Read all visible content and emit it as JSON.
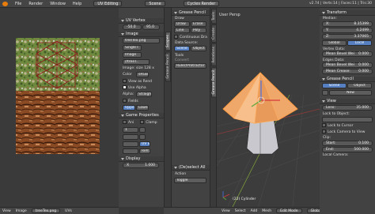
{
  "topbar": {
    "menu": [
      "File",
      "Render",
      "Window",
      "Help"
    ],
    "layout": "UV Editing",
    "scene": "Scene",
    "engine": "Cycles Render",
    "stats": "v2.74 | Verts:14 | Faces:11 | Tris:30"
  },
  "uv_panel": {
    "sec_uv_vertex": "UV Vertex",
    "uv_x": "-50.0",
    "uv_y": "95.0",
    "sec_image": "Image",
    "image_name": "treeTex.png",
    "image_user": "Single I",
    "source": "Image",
    "file": "//treeT..",
    "size": "Image: size 128 x",
    "color_label": "Color",
    "color_value": "sRGB",
    "view_as_render": "View as Rend",
    "use_alpha": "Use Alpha",
    "alpha_label": "Alpha:",
    "alpha_value": "Straight",
    "fields_label": "Fields",
    "upper_first": "Upper First",
    "lower_first": "Lower Fir",
    "sec_game": "Game Properties",
    "animated": "Ani",
    "clamp": "Clamp",
    "sec_display": "Display",
    "aspect_x": "X",
    "aspect_y": "1.000",
    "uv_ed": "UV Ed",
    "refract": "Refract",
    "more": "1"
  },
  "uv_tabs": [
    "Scopes",
    "Grease Pencil"
  ],
  "uv_header": {
    "view": "View",
    "image": "Image",
    "image_name": "treeTex.png",
    "uvs": "UVs"
  },
  "gp": {
    "title": "Grease Pencil",
    "draw": "Draw",
    "erase": "Erase",
    "line": "Line",
    "poly": "Poly",
    "continuous": "Continuous Dra",
    "data_source": "Data Source:",
    "scene": "Scene",
    "object": "Object",
    "tools": "Tools",
    "convert": "Convert",
    "ruler": "Ruler/Protractor",
    "redo": "(De)select All",
    "action_label": "Action",
    "action_value": "Toggle"
  },
  "tool_tabs": [
    "Tools",
    "Create",
    "Relations",
    "Animation",
    "Physics",
    "Shading / UVs",
    "Options",
    "Grease Pencil"
  ],
  "view3d": {
    "title": "User Persp",
    "object_label": "(22) Cylinder"
  },
  "view3d_header": {
    "view": "View",
    "select": "Select",
    "add": "Add",
    "mesh": "Mesh",
    "mode": "Edit Mode",
    "shading": "Global"
  },
  "props": {
    "transform": "Transform",
    "median": "Median:",
    "x": "X:",
    "x_val": "8.35399",
    "y": "Y:",
    "y_val": "4.2499",
    "z": "Z:",
    "z_val": "3.37065",
    "global": "Global",
    "local": "Local",
    "vertex_data": "Vertex Data:",
    "mean_bevel_weight": "Mean Bevel Wei",
    "mbw_val": "0.000",
    "edges_data": "Edges Data:",
    "mean_bevel_weight2": "Mean Bevel Wei",
    "mbw2_val": "0.000",
    "mean_crease": "Mean Crease:",
    "mc_val": "0.000",
    "grease_pencil": "Grease Pencil",
    "gp_scene": "Scene",
    "gp_object": "Object",
    "new": "New",
    "view": "View",
    "lens_label": "Lens:",
    "lens_val": "35.000",
    "lock_object": "Lock to Object:",
    "lock_cursor": "Lock to Cursor",
    "lock_camera": "Lock Camera to View",
    "clip": "Clip:",
    "start_label": "Start:",
    "start_val": "0.100",
    "end_label": "End:",
    "end_val": "500.000",
    "local_camera": "Local Camera:"
  }
}
